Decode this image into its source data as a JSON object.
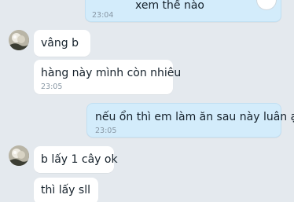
{
  "messages": [
    {
      "text": "xem thế nào",
      "time": "23:04"
    },
    {
      "text": "vâng b"
    },
    {
      "text": "hàng này mình còn nhiêu",
      "time": "23:05"
    },
    {
      "text": "nếu ổn thì em làm ăn sau này luân ạ",
      "time": "23:05"
    },
    {
      "text": "b lấy 1 cây ok"
    },
    {
      "text": "thì lấy sll"
    }
  ],
  "colors": {
    "background": "#e4e9ee",
    "incoming_bubble": "#ffffff",
    "outgoing_bubble": "#d3ecfb",
    "timestamp": "#8796a3"
  }
}
